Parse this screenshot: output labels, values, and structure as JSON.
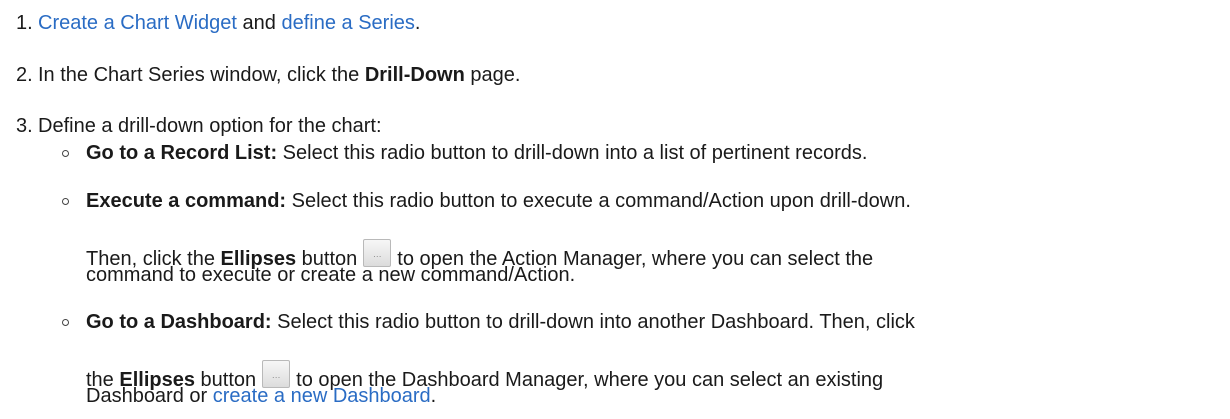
{
  "steps": [
    {
      "number": "1.",
      "link_create_widget": "Create a Chart Widget",
      "and": " and ",
      "link_define_series": "define a Series",
      "end": "."
    },
    {
      "number": "2.",
      "before": "In the Chart Series window, click the ",
      "bold": "Drill-Down",
      "after": " page."
    },
    {
      "number": "3.",
      "text": "Define a drill-down option for the chart:"
    }
  ],
  "options": {
    "record_list": {
      "label": "Go to a Record List:",
      "text": " Select this radio button to drill-down into a list of pertinent records."
    },
    "execute_command": {
      "label": "Execute a command:",
      "text": " Select this radio button to execute a command/Action upon drill-down.",
      "then": "Then, click the ",
      "ellipses": "Ellipses",
      "button_word": " button",
      "after_button": "to open the Action Manager, where you can select the",
      "line3": "command to execute or create a new command/Action."
    },
    "dashboard": {
      "label": "Go to a Dashboard:",
      "text": " Select this radio button to drill-down into another Dashboard. Then, click",
      "the": "the ",
      "ellipses": "Ellipses",
      "button_word": " button",
      "after_button": "to open the Dashboard Manager, where you can select an existing",
      "line3_before": "Dashboard or ",
      "link_create_dashboard": "create a new Dashboard",
      "line3_end": "."
    }
  },
  "ellipsis_glyph": "…",
  "icons": [
    "ellipsis-button-icon"
  ]
}
